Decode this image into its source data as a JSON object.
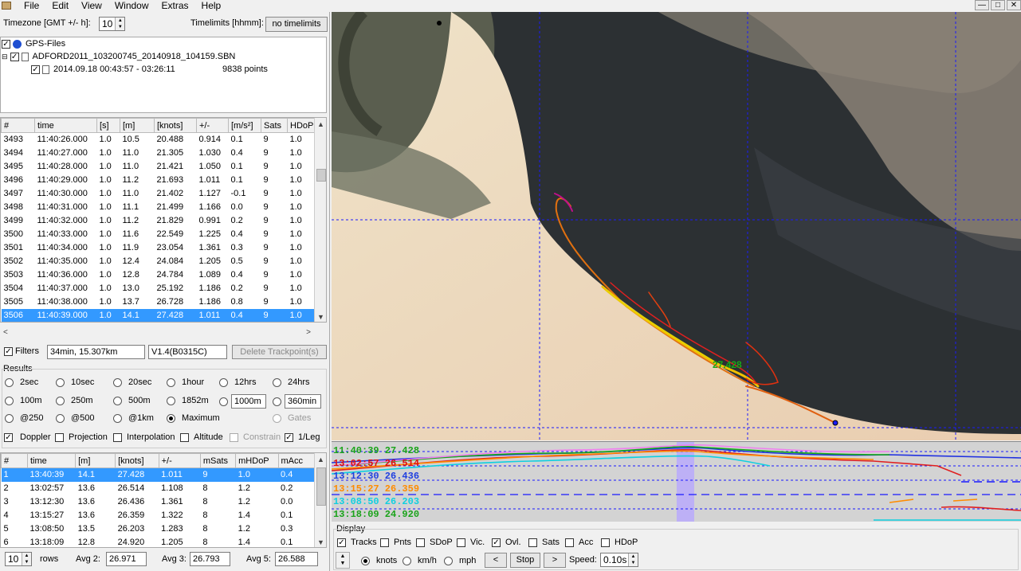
{
  "menu": [
    "File",
    "Edit",
    "View",
    "Window",
    "Extras",
    "Help"
  ],
  "winbtns": [
    "—",
    "□",
    "✕"
  ],
  "settings": {
    "timezone_label": "Timezone [GMT +/- h]:",
    "timezone_value": "10",
    "timelimits_label": "Timelimits [hhmm]:",
    "timelimits_value": "no timelimits"
  },
  "tree": {
    "root": "GPS-Files",
    "file": "ADFORD2011_103200745_20140918_104159.SBN",
    "track": "2014.09.18 00:43:57 - 03:26:11",
    "points": "9838 points"
  },
  "points_table": {
    "headers": [
      "#",
      "time",
      "[s]",
      "[m]",
      "[knots]",
      "+/-",
      "[m/s²]",
      "Sats",
      "HDoP"
    ],
    "rows": [
      [
        "3493",
        "11:40:26.000",
        "1.0",
        "10.5",
        "20.488",
        "0.914",
        "0.1",
        "9",
        "1.0"
      ],
      [
        "3494",
        "11:40:27.000",
        "1.0",
        "11.0",
        "21.305",
        "1.030",
        "0.4",
        "9",
        "1.0"
      ],
      [
        "3495",
        "11:40:28.000",
        "1.0",
        "11.0",
        "21.421",
        "1.050",
        "0.1",
        "9",
        "1.0"
      ],
      [
        "3496",
        "11:40:29.000",
        "1.0",
        "11.2",
        "21.693",
        "1.011",
        "0.1",
        "9",
        "1.0"
      ],
      [
        "3497",
        "11:40:30.000",
        "1.0",
        "11.0",
        "21.402",
        "1.127",
        "-0.1",
        "9",
        "1.0"
      ],
      [
        "3498",
        "11:40:31.000",
        "1.0",
        "11.1",
        "21.499",
        "1.166",
        "0.0",
        "9",
        "1.0"
      ],
      [
        "3499",
        "11:40:32.000",
        "1.0",
        "11.2",
        "21.829",
        "0.991",
        "0.2",
        "9",
        "1.0"
      ],
      [
        "3500",
        "11:40:33.000",
        "1.0",
        "11.6",
        "22.549",
        "1.225",
        "0.4",
        "9",
        "1.0"
      ],
      [
        "3501",
        "11:40:34.000",
        "1.0",
        "11.9",
        "23.054",
        "1.361",
        "0.3",
        "9",
        "1.0"
      ],
      [
        "3502",
        "11:40:35.000",
        "1.0",
        "12.4",
        "24.084",
        "1.205",
        "0.5",
        "9",
        "1.0"
      ],
      [
        "3503",
        "11:40:36.000",
        "1.0",
        "12.8",
        "24.784",
        "1.089",
        "0.4",
        "9",
        "1.0"
      ],
      [
        "3504",
        "11:40:37.000",
        "1.0",
        "13.0",
        "25.192",
        "1.186",
        "0.2",
        "9",
        "1.0"
      ],
      [
        "3505",
        "11:40:38.000",
        "1.0",
        "13.7",
        "26.728",
        "1.186",
        "0.8",
        "9",
        "1.0"
      ],
      [
        "3506",
        "11:40:39.000",
        "1.0",
        "14.1",
        "27.428",
        "1.011",
        "0.4",
        "9",
        "1.0"
      ]
    ]
  },
  "filters": {
    "label": "Filters",
    "summary": "34min, 15.307km",
    "version": "V1.4(B0315C)",
    "delete_button": "Delete Trackpoint(s)"
  },
  "results": {
    "label": "Results",
    "row1": [
      "2sec",
      "10sec",
      "20sec",
      "1hour",
      "12hrs",
      "24hrs"
    ],
    "row2": [
      "100m",
      "250m",
      "500m",
      "1852m"
    ],
    "row2_custom1": "1000m",
    "row2_custom2": "360min",
    "row3": [
      "@250",
      "@500",
      "@1km",
      "Maximum",
      "Gates"
    ],
    "row4": [
      "Doppler",
      "Projection",
      "Interpolation",
      "Altitude",
      "Constrain",
      "1/Leg"
    ]
  },
  "results_table": {
    "headers": [
      "#",
      "time",
      "[m]",
      "[knots]",
      "+/-",
      "mSats",
      "mHDoP",
      "mAcc"
    ],
    "rows": [
      [
        "1",
        "13:40:39",
        "14.1",
        "27.428",
        "1.011",
        "9",
        "1.0",
        "0.4"
      ],
      [
        "2",
        "13:02:57",
        "13.6",
        "26.514",
        "1.108",
        "8",
        "1.2",
        "0.2"
      ],
      [
        "3",
        "13:12:30",
        "13.6",
        "26.436",
        "1.361",
        "8",
        "1.2",
        "0.0"
      ],
      [
        "4",
        "13:15:27",
        "13.6",
        "26.359",
        "1.322",
        "8",
        "1.4",
        "0.1"
      ],
      [
        "5",
        "13:08:50",
        "13.5",
        "26.203",
        "1.283",
        "8",
        "1.2",
        "0.3"
      ],
      [
        "6",
        "13:18:09",
        "12.8",
        "24.920",
        "1.205",
        "8",
        "1.4",
        "0.1"
      ]
    ]
  },
  "bottom": {
    "rows_value": "10",
    "rows_label": "rows",
    "avg2_label": "Avg 2:",
    "avg2": "26.971",
    "avg3_label": "Avg 3:",
    "avg3": "26.793",
    "avg5_label": "Avg 5:",
    "avg5": "26.588"
  },
  "map": {
    "speed_label": "27.428"
  },
  "timeline": [
    {
      "text": "11:40:39 27.428",
      "color": "#1aa31a"
    },
    {
      "text": "13:02:57 26.514",
      "color": "#e01010"
    },
    {
      "text": "13:12:30 26.436",
      "color": "#2040e0"
    },
    {
      "text": "13:15:27 26.359",
      "color": "#ff8c00"
    },
    {
      "text": "13:08:50 26.203",
      "color": "#10d0e0"
    },
    {
      "text": "13:18:09 24.920",
      "color": "#1aa31a"
    }
  ],
  "display": {
    "label": "Display",
    "options": [
      "Tracks",
      "Pnts",
      "SDoP",
      "Vic.",
      "Ovl.",
      "Sats",
      "Acc",
      "HDoP"
    ],
    "units": [
      "knots",
      "km/h",
      "mph"
    ],
    "prev": "<",
    "stop": "Stop",
    "next": ">",
    "speed_label": "Speed:",
    "speed_value": "0.10s"
  }
}
